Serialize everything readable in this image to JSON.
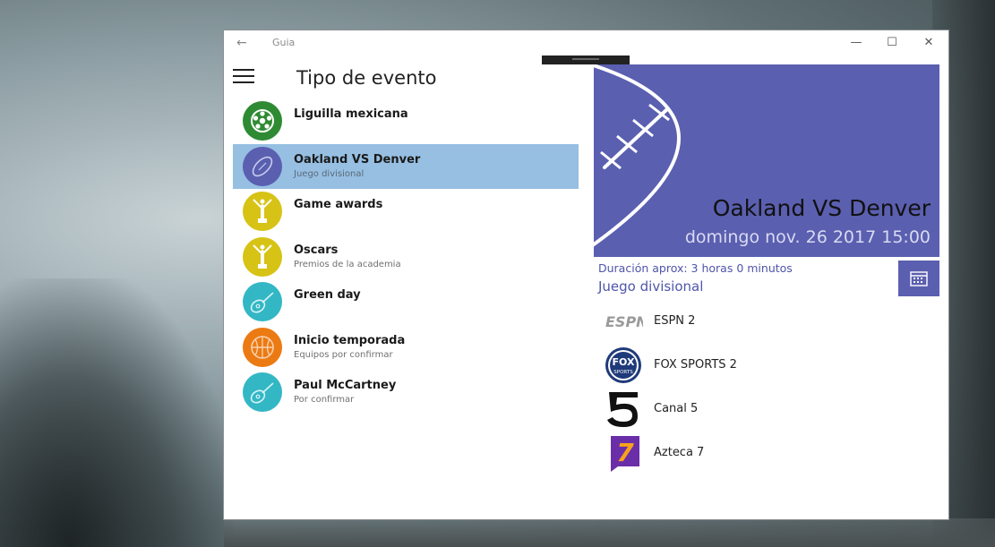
{
  "window": {
    "app_title": "Guia",
    "back_glyph": "←",
    "min_glyph": "—",
    "max_glyph": "☐",
    "close_glyph": "✕"
  },
  "sidebar": {
    "menu_icon": "hamburger-icon",
    "title": "Tipo de evento"
  },
  "events": [
    {
      "name": "Liguilla mexicana",
      "sub": "",
      "icon": "soccer-ball-icon",
      "color": "#2e8b33",
      "selected": false
    },
    {
      "name": "Oakland VS Denver",
      "sub": "Juego divisional",
      "icon": "football-icon",
      "color": "#5a5fb0",
      "selected": true
    },
    {
      "name": "Game awards",
      "sub": "",
      "icon": "trophy-icon",
      "color": "#d6c315",
      "selected": false
    },
    {
      "name": "Oscars",
      "sub": "Premios de la academia",
      "icon": "trophy-icon",
      "color": "#d6c315",
      "selected": false
    },
    {
      "name": "Green day",
      "sub": "",
      "icon": "guitar-icon",
      "color": "#33b7c5",
      "selected": false
    },
    {
      "name": "Inicio temporada",
      "sub": "Equipos por confirmar",
      "icon": "basketball-icon",
      "color": "#ec7a12",
      "selected": false
    },
    {
      "name": "Paul McCartney",
      "sub": "Por confirmar",
      "icon": "guitar-icon",
      "color": "#33b7c5",
      "selected": false
    }
  ],
  "detail": {
    "title": "Oakland VS Denver",
    "datetime": "domingo nov. 26 2017 15:00",
    "duration": "Duración aprox: 3 horas 0 minutos",
    "event_type": "Juego divisional",
    "accent": "#5a5fb0",
    "calendar_icon": "calendar-icon"
  },
  "channels": [
    {
      "name": "ESPN 2",
      "logo": "espn-logo",
      "logo_text": "ESPN"
    },
    {
      "name": "FOX SPORTS 2",
      "logo": "fox-sports-logo",
      "logo_text": "FOX SPORTS"
    },
    {
      "name": "Canal 5",
      "logo": "canal5-logo",
      "logo_text": "5"
    },
    {
      "name": "Azteca 7",
      "logo": "azteca7-logo",
      "logo_text": "7"
    }
  ]
}
